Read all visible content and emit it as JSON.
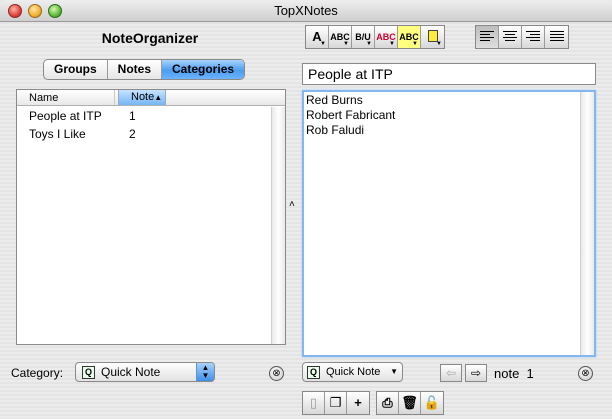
{
  "window": {
    "title": "TopXNotes"
  },
  "organizer": {
    "title": "NoteOrganizer",
    "tabs": [
      "Groups",
      "Notes",
      "Categories"
    ],
    "selected_tab": "Categories",
    "columns": [
      "Name",
      "Note"
    ],
    "sorted_column": "Note",
    "rows": [
      {
        "name": "People at ITP",
        "count": "1"
      },
      {
        "name": "Toys I Like",
        "count": "2"
      }
    ],
    "category_label": "Category:",
    "category_value": "Quick Note",
    "category_icon": "Q"
  },
  "toolbar": {
    "font": "A",
    "size": "ABC",
    "style": "B/U",
    "color": "ABC",
    "highlight": "ABC"
  },
  "note": {
    "title": "People at ITP",
    "lines": [
      "Red Burns",
      "Robert Fabricant",
      "Rob Faludi"
    ],
    "category_value": "Quick Note",
    "category_icon": "Q",
    "note_label": "note",
    "note_number": "1"
  },
  "colors": {
    "accent": "#4c9df0",
    "focus": "#86b6ee"
  }
}
